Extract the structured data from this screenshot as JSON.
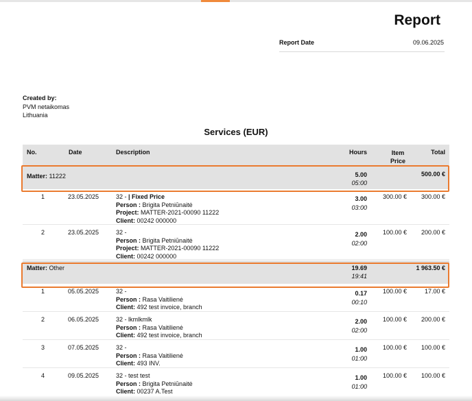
{
  "report": {
    "title": "Report",
    "date_label": "Report Date",
    "date_value": "09.06.2025"
  },
  "created_by": {
    "label": "Created by:",
    "name": "PVM netaikomas",
    "country": "Lithuania"
  },
  "section_title": "Services (EUR)",
  "table": {
    "headers": {
      "no": "No.",
      "date": "Date",
      "description": "Description",
      "hours": "Hours",
      "item_price_1": "Item",
      "item_price_2": "Price",
      "total": "Total"
    },
    "matters": [
      {
        "label": "Matter:",
        "name": "11222",
        "hours": "5.00",
        "time": "05:00",
        "total": "500.00 €",
        "rows": [
          {
            "no": "1",
            "date": "23.05.2025",
            "desc_prefix": "32 - ",
            "desc_bold": "| Fixed Price",
            "person_label": "Person :",
            "person": "Brigita Petniūnaitė",
            "project_label": "Project:",
            "project": "MATTER-2021-00090  11222",
            "client_label": "Client:",
            "client": "00242  000000",
            "hours": "3.00",
            "time": "03:00",
            "price": "300.00 €",
            "total": "300.00 €"
          },
          {
            "no": "2",
            "date": "23.05.2025",
            "desc_prefix": "32 -",
            "desc_bold": "",
            "person_label": "Person :",
            "person": "Brigita Petniūnaitė",
            "project_label": "Project:",
            "project": "MATTER-2021-00090  11222",
            "client_label": "Client:",
            "client": "00242  000000",
            "hours": "2.00",
            "time": "02:00",
            "price": "100.00 €",
            "total": "200.00 €"
          }
        ]
      },
      {
        "label": "Matter:",
        "name": "Other",
        "hours": "19.69",
        "time": "19:41",
        "total": "1 963.50 €",
        "rows": [
          {
            "no": "1",
            "date": "05.05.2025",
            "desc_prefix": "32 -",
            "desc_bold": "",
            "person_label": "Person :",
            "person": "Rasa Vaitilienė",
            "client_label": "Client:",
            "client": "492  test invoice, branch",
            "hours": "0.17",
            "time": "00:10",
            "price": "100.00 €",
            "total": "17.00 €"
          },
          {
            "no": "2",
            "date": "06.05.2025",
            "desc_prefix": "32 - lkmlkmlk",
            "desc_bold": "",
            "person_label": "Person :",
            "person": "Rasa Vaitilienė",
            "client_label": "Client:",
            "client": "492  test invoice, branch",
            "hours": "2.00",
            "time": "02:00",
            "price": "100.00 €",
            "total": "200.00 €"
          },
          {
            "no": "3",
            "date": "07.05.2025",
            "desc_prefix": "32 -",
            "desc_bold": "",
            "person_label": "Person :",
            "person": "Rasa Vaitilienė",
            "client_label": "Client:",
            "client": "493  INV.",
            "hours": "1.00",
            "time": "01:00",
            "price": "100.00 €",
            "total": "100.00 €"
          },
          {
            "no": "4",
            "date": "09.05.2025",
            "desc_prefix": "32 - test test",
            "desc_bold": "",
            "person_label": "Person :",
            "person": "Brigita Petniūnaitė",
            "client_label": "Client:",
            "client": "00237  A.Test",
            "hours": "1.00",
            "time": "01:00",
            "price": "100.00 €",
            "total": "100.00 €"
          }
        ]
      }
    ]
  },
  "colors": {
    "highlight": "#ea7a2e",
    "header_bg": "#e2e2e2",
    "accent": "#f08a3c"
  }
}
